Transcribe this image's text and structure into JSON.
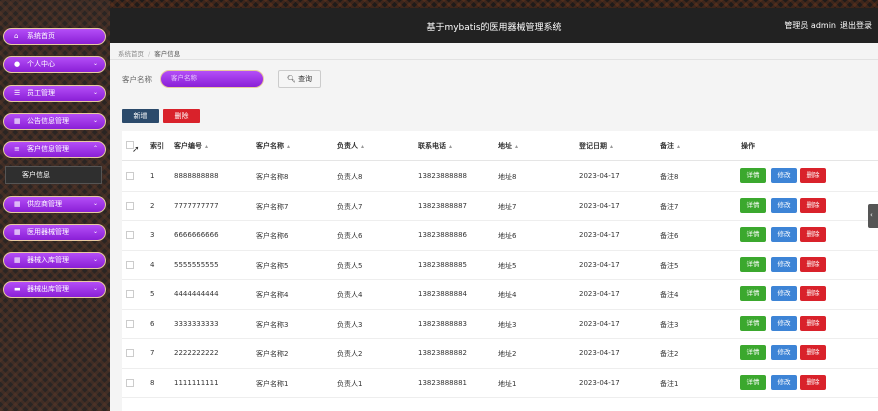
{
  "header": {
    "title": "基于mybatis的医用器械管理系统",
    "user_label": "管理员 admin",
    "logout_label": "退出登录"
  },
  "sidebar": {
    "items": [
      {
        "label": "系统首页",
        "icon": "home-icon",
        "glyph": "⌂",
        "chevron": false
      },
      {
        "label": "个人中心",
        "icon": "user-icon",
        "glyph": "●",
        "chevron": true
      },
      {
        "label": "员工管理",
        "icon": "sliders-icon",
        "glyph": "☰",
        "chevron": true
      },
      {
        "label": "公告信息管理",
        "icon": "calendar-icon",
        "glyph": "▦",
        "chevron": true
      },
      {
        "label": "客户信息管理",
        "icon": "list-icon",
        "glyph": "≡",
        "chevron": true
      },
      {
        "label": "供应商管理",
        "icon": "grid-icon",
        "glyph": "▦",
        "chevron": true
      },
      {
        "label": "医用器械管理",
        "icon": "grid-icon",
        "glyph": "▦",
        "chevron": true
      },
      {
        "label": "器械入库管理",
        "icon": "grid-icon",
        "glyph": "▦",
        "chevron": true
      },
      {
        "label": "器械出库管理",
        "icon": "card-icon",
        "glyph": "▬",
        "chevron": true
      }
    ],
    "submenu": {
      "label": "客户信息"
    }
  },
  "breadcrumb": {
    "home": "系统首页",
    "current": "客户信息"
  },
  "search": {
    "label": "客户名称",
    "placeholder": "客户名称",
    "button_label": "查询"
  },
  "actions": {
    "add_label": "新增",
    "delete_label": "删除"
  },
  "table": {
    "columns": [
      "索引",
      "客户编号",
      "客户名称",
      "负责人",
      "联系电话",
      "地址",
      "登记日期",
      "备注",
      "操作"
    ],
    "row_actions": {
      "detail": "详情",
      "edit": "修改",
      "delete": "删除"
    },
    "rows": [
      {
        "index": "1",
        "code": "8888888888",
        "name": "客户名称8",
        "owner": "负责人8",
        "phone": "13823888888",
        "address": "地址8",
        "date": "2023-04-17",
        "note": "备注8"
      },
      {
        "index": "2",
        "code": "7777777777",
        "name": "客户名称7",
        "owner": "负责人7",
        "phone": "13823888887",
        "address": "地址7",
        "date": "2023-04-17",
        "note": "备注7"
      },
      {
        "index": "3",
        "code": "6666666666",
        "name": "客户名称6",
        "owner": "负责人6",
        "phone": "13823888886",
        "address": "地址6",
        "date": "2023-04-17",
        "note": "备注6"
      },
      {
        "index": "4",
        "code": "5555555555",
        "name": "客户名称5",
        "owner": "负责人5",
        "phone": "13823888885",
        "address": "地址5",
        "date": "2023-04-17",
        "note": "备注5"
      },
      {
        "index": "5",
        "code": "4444444444",
        "name": "客户名称4",
        "owner": "负责人4",
        "phone": "13823888884",
        "address": "地址4",
        "date": "2023-04-17",
        "note": "备注4"
      },
      {
        "index": "6",
        "code": "3333333333",
        "name": "客户名称3",
        "owner": "负责人3",
        "phone": "13823888883",
        "address": "地址3",
        "date": "2023-04-17",
        "note": "备注3"
      },
      {
        "index": "7",
        "code": "2222222222",
        "name": "客户名称2",
        "owner": "负责人2",
        "phone": "13823888882",
        "address": "地址2",
        "date": "2023-04-17",
        "note": "备注2"
      },
      {
        "index": "8",
        "code": "1111111111",
        "name": "客户名称1",
        "owner": "负责人1",
        "phone": "13823888881",
        "address": "地址1",
        "date": "2023-04-17",
        "note": "备注1"
      }
    ]
  },
  "colors": {
    "menu": "#9b33e8",
    "menu_border": "#e6c9a0",
    "add": "#2b4a6b",
    "delete": "#d9222b",
    "detail": "#3ba82e",
    "edit": "#3d84d6"
  }
}
